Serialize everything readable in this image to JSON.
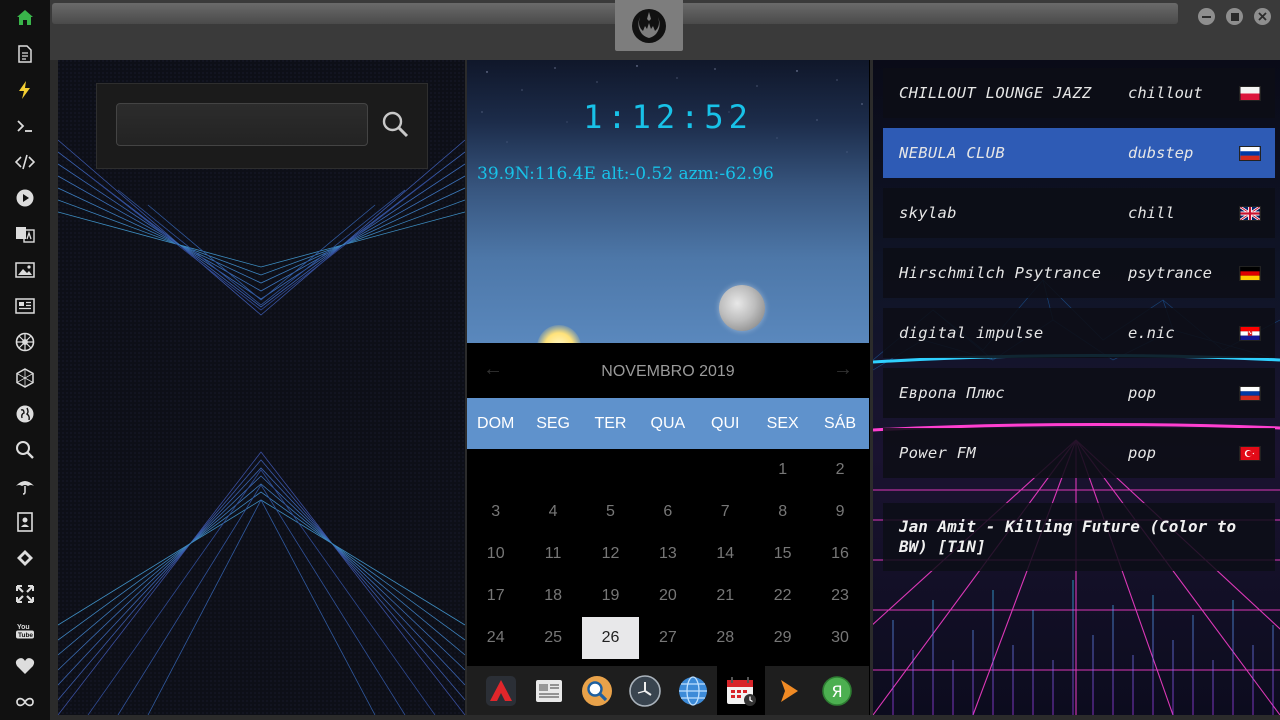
{
  "sidebar": {
    "items": [
      {
        "name": "home-icon",
        "glyph": "home"
      },
      {
        "name": "document-icon",
        "glyph": "doc"
      },
      {
        "name": "bolt-icon",
        "glyph": "bolt"
      },
      {
        "name": "terminal-icon",
        "glyph": ">_"
      },
      {
        "name": "code-icon",
        "glyph": "</>"
      },
      {
        "name": "play-icon",
        "glyph": "play"
      },
      {
        "name": "translate-icon",
        "glyph": "translate"
      },
      {
        "name": "image-icon",
        "glyph": "image"
      },
      {
        "name": "news-icon",
        "glyph": "news"
      },
      {
        "name": "empire-icon",
        "glyph": "empire"
      },
      {
        "name": "hexagon-icon",
        "glyph": "hex"
      },
      {
        "name": "globe-icon",
        "glyph": "globe"
      },
      {
        "name": "search-icon",
        "glyph": "search"
      },
      {
        "name": "umbrella-icon",
        "glyph": "umbrella"
      },
      {
        "name": "contacts-icon",
        "glyph": "contacts"
      },
      {
        "name": "exchange-icon",
        "glyph": "exchange"
      },
      {
        "name": "expand-icon",
        "glyph": "expand"
      },
      {
        "name": "youtube-icon",
        "glyph": "youtube"
      },
      {
        "name": "heart-icon",
        "glyph": "heart"
      },
      {
        "name": "infinity-icon",
        "glyph": "infinity"
      }
    ]
  },
  "search": {
    "value": "",
    "placeholder": ""
  },
  "sky": {
    "clock": "1:12:52",
    "coords": "39.9N:116.4E  alt:-0.52 azm:-62.96"
  },
  "calendar": {
    "month_label": "NOVEMBRO 2019",
    "prev_label": "←",
    "next_label": "→",
    "weekdays": [
      "DOM",
      "SEG",
      "TER",
      "QUA",
      "QUI",
      "SEX",
      "SÁB"
    ],
    "weeks": [
      [
        "",
        "",
        "",
        "",
        "",
        "1",
        "2"
      ],
      [
        "3",
        "4",
        "5",
        "6",
        "7",
        "8",
        "9"
      ],
      [
        "10",
        "11",
        "12",
        "13",
        "14",
        "15",
        "16"
      ],
      [
        "17",
        "18",
        "19",
        "20",
        "21",
        "22",
        "23"
      ],
      [
        "24",
        "25",
        "26",
        "27",
        "28",
        "29",
        "30"
      ]
    ],
    "today": "26"
  },
  "dock": {
    "items": [
      "app-launcher-icon",
      "news-reader-icon",
      "search-app-icon",
      "clock-app-icon",
      "browser-globe-icon",
      "calendar-app-icon",
      "media-player-icon",
      "yandex-icon"
    ]
  },
  "radio": {
    "stations": [
      {
        "name": "CHILLOUT LOUNGE JAZZ",
        "genre": "chillout",
        "flag": "pl"
      },
      {
        "name": "NEBULA CLUB",
        "genre": "dubstep",
        "flag": "ru"
      },
      {
        "name": "skylab",
        "genre": "chill",
        "flag": "gb"
      },
      {
        "name": "Hirschmilch Psytrance",
        "genre": "psytrance",
        "flag": "de"
      },
      {
        "name": "digital impulse",
        "genre": "e.nic",
        "flag": "hr"
      },
      {
        "name": "Европа Плюс",
        "genre": "pop",
        "flag": "ru"
      },
      {
        "name": "Power FM",
        "genre": "pop",
        "flag": "tr"
      }
    ],
    "active_index": 1,
    "now_playing": "Jan Amit - Killing Future (Color to BW) [T1N]"
  },
  "colors": {
    "accent": "#18c2e8",
    "calendar_header": "#5f92cc",
    "active_station": "#2e5bb5"
  }
}
